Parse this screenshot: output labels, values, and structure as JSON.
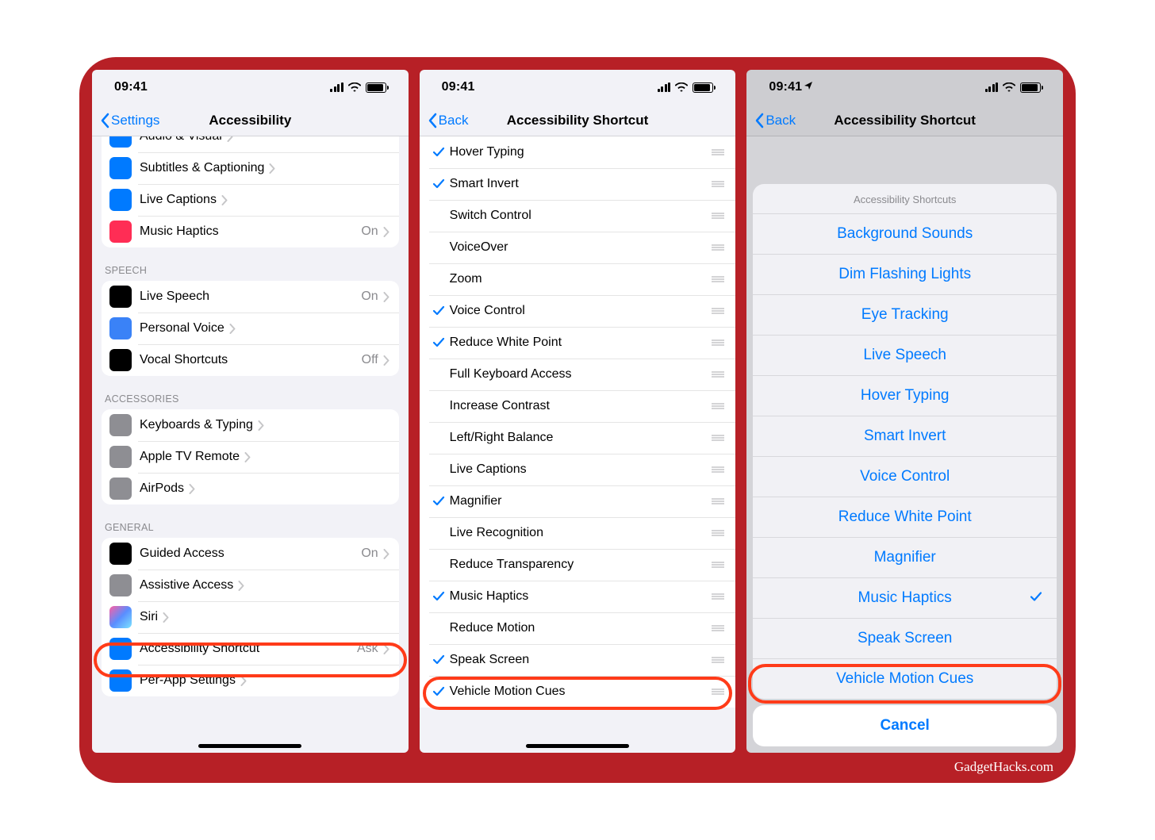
{
  "credit": "GadgetHacks.com",
  "statusTime": "09:41",
  "s1": {
    "back": "Settings",
    "title": "Accessibility",
    "rowsTop": [
      {
        "icon": "ic-av",
        "label": "Audio & Visual",
        "detail": ""
      },
      {
        "icon": "ic-sub",
        "label": "Subtitles & Captioning",
        "detail": ""
      },
      {
        "icon": "ic-live",
        "label": "Live Captions",
        "detail": ""
      },
      {
        "icon": "ic-haptic",
        "label": "Music Haptics",
        "detail": "On"
      }
    ],
    "speechHdr": "Speech",
    "rowsSpeech": [
      {
        "icon": "ic-speech",
        "label": "Live Speech",
        "detail": "On"
      },
      {
        "icon": "ic-pvoice",
        "label": "Personal Voice",
        "detail": ""
      },
      {
        "icon": "ic-vshort",
        "label": "Vocal Shortcuts",
        "detail": "Off"
      }
    ],
    "accHdr": "Accessories",
    "rowsAcc": [
      {
        "icon": "ic-kb",
        "label": "Keyboards & Typing",
        "detail": ""
      },
      {
        "icon": "ic-remote",
        "label": "Apple TV Remote",
        "detail": ""
      },
      {
        "icon": "ic-airpods",
        "label": "AirPods",
        "detail": ""
      }
    ],
    "genHdr": "General",
    "rowsGen": [
      {
        "icon": "ic-guided",
        "label": "Guided Access",
        "detail": "On"
      },
      {
        "icon": "ic-assist",
        "label": "Assistive Access",
        "detail": ""
      },
      {
        "icon": "ic-siri",
        "label": "Siri",
        "detail": ""
      },
      {
        "icon": "ic-acc",
        "label": "Accessibility Shortcut",
        "detail": "Ask"
      },
      {
        "icon": "ic-perapp",
        "label": "Per-App Settings",
        "detail": ""
      }
    ]
  },
  "s2": {
    "back": "Back",
    "title": "Accessibility Shortcut",
    "rows": [
      {
        "c": true,
        "label": "Hover Typing"
      },
      {
        "c": true,
        "label": "Smart Invert"
      },
      {
        "c": false,
        "label": "Switch Control"
      },
      {
        "c": false,
        "label": "VoiceOver"
      },
      {
        "c": false,
        "label": "Zoom"
      },
      {
        "c": true,
        "label": "Voice Control"
      },
      {
        "c": true,
        "label": "Reduce White Point"
      },
      {
        "c": false,
        "label": "Full Keyboard Access"
      },
      {
        "c": false,
        "label": "Increase Contrast"
      },
      {
        "c": false,
        "label": "Left/Right Balance"
      },
      {
        "c": false,
        "label": "Live Captions"
      },
      {
        "c": true,
        "label": "Magnifier"
      },
      {
        "c": false,
        "label": "Live Recognition"
      },
      {
        "c": false,
        "label": "Reduce Transparency"
      },
      {
        "c": true,
        "label": "Music Haptics"
      },
      {
        "c": false,
        "label": "Reduce Motion"
      },
      {
        "c": true,
        "label": "Speak Screen"
      },
      {
        "c": true,
        "label": "Vehicle Motion Cues"
      }
    ]
  },
  "s3": {
    "back": "Back",
    "title": "Accessibility Shortcut",
    "sheetTitle": "Accessibility Shortcuts",
    "items": [
      {
        "label": "Background Sounds",
        "c": false
      },
      {
        "label": "Dim Flashing Lights",
        "c": false
      },
      {
        "label": "Eye Tracking",
        "c": false
      },
      {
        "label": "Live Speech",
        "c": false
      },
      {
        "label": "Hover Typing",
        "c": false
      },
      {
        "label": "Smart Invert",
        "c": false
      },
      {
        "label": "Voice Control",
        "c": false
      },
      {
        "label": "Reduce White Point",
        "c": false
      },
      {
        "label": "Magnifier",
        "c": false
      },
      {
        "label": "Music Haptics",
        "c": true
      },
      {
        "label": "Speak Screen",
        "c": false
      },
      {
        "label": "Vehicle Motion Cues",
        "c": false
      }
    ],
    "cancel": "Cancel"
  }
}
